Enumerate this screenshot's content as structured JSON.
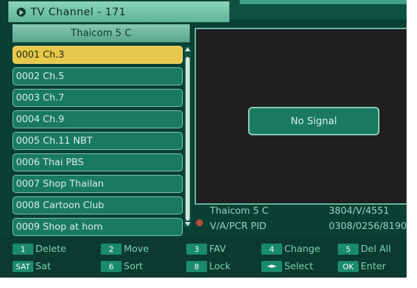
{
  "title": {
    "text": "TV Channel - 171"
  },
  "satellite": "Thaicom 5 C",
  "channels": [
    {
      "label": "0001 Ch.3"
    },
    {
      "label": "0002 Ch.5"
    },
    {
      "label": "0003 Ch.7"
    },
    {
      "label": "0004 Ch.9"
    },
    {
      "label": "0005 Ch.11 NBT"
    },
    {
      "label": "0006 Thai PBS"
    },
    {
      "label": "0007 Shop Thailan"
    },
    {
      "label": "0008 Cartoon Club"
    },
    {
      "label": "0009 Shop at hom"
    }
  ],
  "preview": {
    "message": "No Signal"
  },
  "info": {
    "sat_name": "Thaicom 5 C",
    "freq": "3804/V/4551",
    "pid_label": "V/A/PCR PID",
    "pid_values": "0308/0256/8190"
  },
  "footer": {
    "delete": {
      "key": "1",
      "label": "Delete"
    },
    "move": {
      "key": "2",
      "label": "Move"
    },
    "fav": {
      "key": "3",
      "label": "FAV"
    },
    "change": {
      "key": "4",
      "label": "Change"
    },
    "delall": {
      "key": "5",
      "label": "Del All"
    },
    "sat": {
      "key": "SAT",
      "label": "Sat"
    },
    "sort": {
      "key": "6",
      "label": "Sort"
    },
    "lock": {
      "key": "8",
      "label": "Lock"
    },
    "select": {
      "key": "◄►",
      "label": "Select"
    },
    "enter": {
      "key": "OK",
      "label": "Enter"
    }
  },
  "colors": {
    "selected": "#e8c84a",
    "item": "#1a7a60",
    "background": "#0a3f33",
    "accent_text": "#8fd7b9"
  },
  "icons": [
    "play-circle-icon",
    "scroll-up-arrow-icon",
    "scroll-down-arrow-icon",
    "signal-status-icon",
    "left-right-arrows-icon"
  ]
}
